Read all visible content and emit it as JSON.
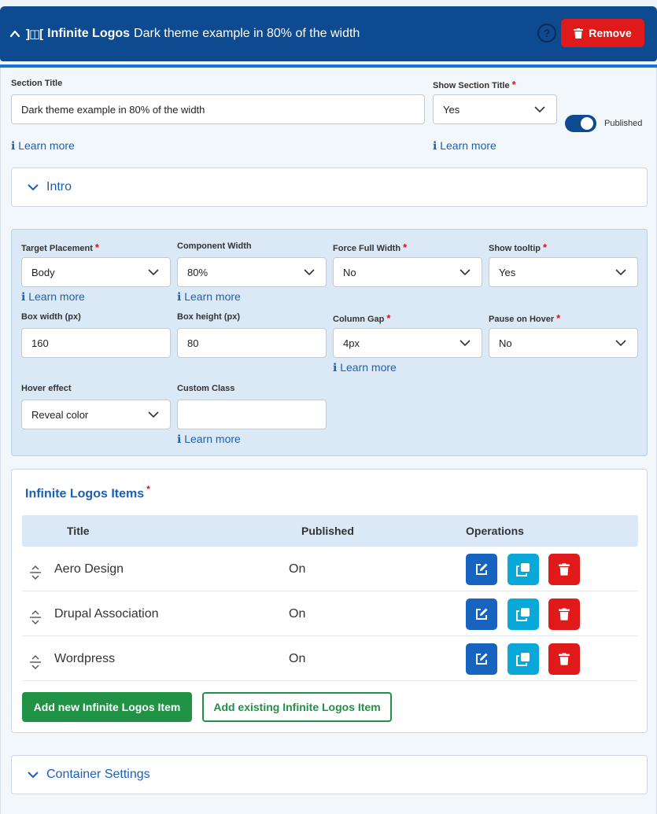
{
  "header": {
    "logo_glyph": "]◫[",
    "component_name": "Infinite Logos",
    "section_subtitle": "Dark theme example in 80% of the width",
    "help_glyph": "?",
    "remove_label": "Remove"
  },
  "section": {
    "title_label": "Section Title",
    "title_value": "Dark theme example in 80% of the width",
    "show_title_label": "Show Section Title",
    "show_title_value": "Yes",
    "learn_more": "ℹ Learn more",
    "published_label": "Published",
    "published": true
  },
  "intro": {
    "title": "Intro"
  },
  "settings": {
    "target_placement": {
      "label": "Target Placement",
      "value": "Body"
    },
    "component_width": {
      "label": "Component Width",
      "value": "80%"
    },
    "force_full_width": {
      "label": "Force Full Width",
      "value": "No"
    },
    "show_tooltip": {
      "label": "Show tooltip",
      "value": "Yes"
    },
    "box_width": {
      "label": "Box width (px)",
      "value": "160"
    },
    "box_height": {
      "label": "Box height (px)",
      "value": "80"
    },
    "column_gap": {
      "label": "Column Gap",
      "value": "4px"
    },
    "pause_on_hover": {
      "label": "Pause on Hover",
      "value": "No"
    },
    "hover_effect": {
      "label": "Hover effect",
      "value": "Reveal color"
    },
    "custom_class": {
      "label": "Custom Class",
      "value": ""
    },
    "learn_more": "ℹ Learn more"
  },
  "items": {
    "title": "Infinite Logos Items",
    "columns": {
      "title": "Title",
      "published": "Published",
      "operations": "Operations"
    },
    "rows": [
      {
        "title": "Aero Design",
        "published": "On"
      },
      {
        "title": "Drupal Association",
        "published": "On"
      },
      {
        "title": "Wordpress",
        "published": "On"
      }
    ],
    "add_new_label": "Add new Infinite Logos Item",
    "add_existing_label": "Add existing Infinite Logos Item"
  },
  "container": {
    "title": "Container Settings"
  },
  "colors": {
    "header_bg": "#0e4a8f",
    "remove_red": "#e01a1a",
    "link_blue": "#1a60b5",
    "edit_blue": "#1764c0",
    "duplicate_cyan": "#0aa8d8",
    "add_green": "#1f9245"
  },
  "icons": {
    "collapse": "chevron-up-icon",
    "logo": "infinite-logos-icon",
    "help": "help-circle-icon",
    "trash": "trash-icon",
    "select": "chevron-down-icon",
    "expand": "chevron-down-icon",
    "drag": "drag-handle-icon",
    "edit": "edit-icon",
    "duplicate": "duplicate-icon"
  }
}
